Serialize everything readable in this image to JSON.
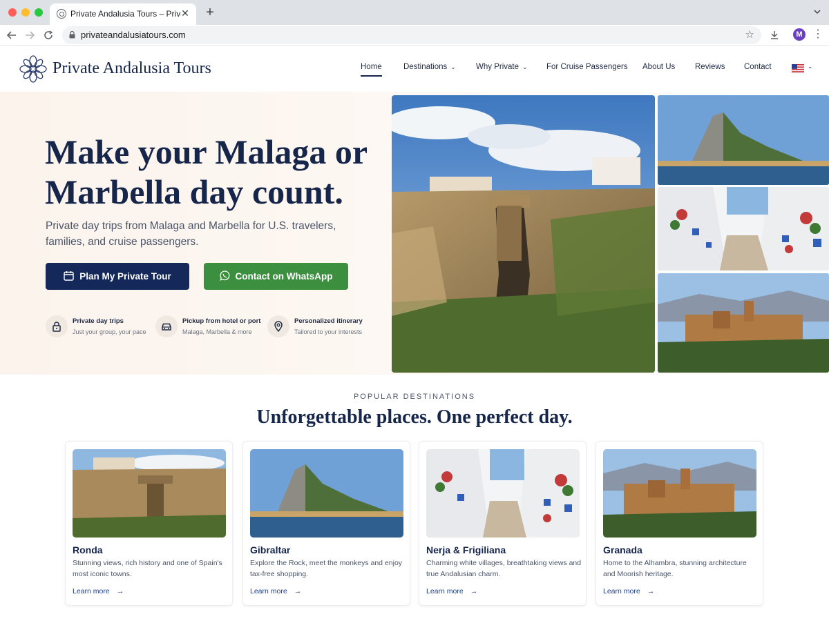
{
  "browser": {
    "tab_title": "Private Andalusia Tours – Private",
    "tab_close": "✕",
    "new_tab": "+",
    "url": "privateandalusiatours.com",
    "profile_initial": "M"
  },
  "header": {
    "logo_text": "Private Andalusia Tours",
    "nav": [
      {
        "label": "Home"
      },
      {
        "label": "Destinations"
      },
      {
        "label": "Why Private"
      },
      {
        "label": "For Cruise Passengers"
      },
      {
        "label": "About Us"
      },
      {
        "label": "Reviews"
      },
      {
        "label": "Contact"
      }
    ]
  },
  "hero": {
    "title": "Make your Malaga or Marbella day count.",
    "subtitle": "Private day trips from Malaga and Marbella for U.S. travelers, families, and cruise passengers.",
    "cta_primary": "Plan My Private Tour",
    "cta_whatsapp": "Contact on WhatsApp",
    "features": [
      {
        "title": "Private day trips",
        "desc": "Just your group, your pace",
        "icon": "lock-icon"
      },
      {
        "title": "Pickup from hotel or port",
        "desc": "Malaga, Marbella & more",
        "icon": "car-icon"
      },
      {
        "title": "Personalized itinerary",
        "desc": "Tailored to your interests",
        "icon": "location-pin-icon"
      }
    ]
  },
  "destinations": {
    "kicker": "POPULAR DESTINATIONS",
    "title": "Unforgettable places. One perfect day.",
    "link_label": "Learn more",
    "cards": [
      {
        "title": "Ronda",
        "desc": "Stunning views, rich history and one of Spain's most iconic towns."
      },
      {
        "title": "Gibraltar",
        "desc": "Explore the Rock, meet the monkeys and enjoy tax-free shopping."
      },
      {
        "title": "Nerja & Frigiliana",
        "desc": "Charming white villages, breathtaking views and true Andalusian charm."
      },
      {
        "title": "Granada",
        "desc": "Home to the Alhambra, stunning architecture and Moorish heritage."
      }
    ]
  },
  "colors": {
    "navy": "#16254a",
    "primary_button": "#14285a",
    "whatsapp_green": "#3c8f3f",
    "link_blue": "#1f3d8c"
  }
}
